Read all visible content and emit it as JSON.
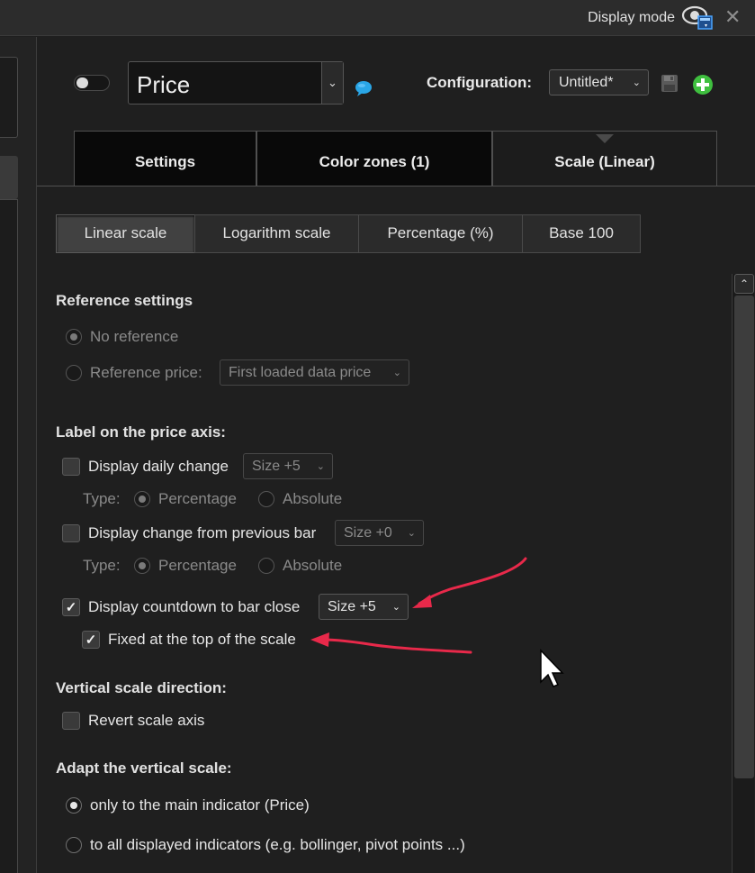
{
  "topbar": {
    "display_mode_label": "Display mode",
    "close_glyph": "✕"
  },
  "indicator": {
    "name": "Price",
    "chevron": "⌄"
  },
  "configuration": {
    "label": "Configuration:",
    "value": "Untitled*",
    "chevron": "⌄"
  },
  "tabs": [
    {
      "label": "Settings"
    },
    {
      "label": "Color zones (1)"
    },
    {
      "label": "Scale (Linear)"
    }
  ],
  "scale_types": [
    {
      "label": "Linear scale"
    },
    {
      "label": "Logarithm scale"
    },
    {
      "label": "Percentage (%)"
    },
    {
      "label": "Base 100"
    }
  ],
  "reference": {
    "heading": "Reference settings",
    "no_reference": "No reference",
    "reference_price": "Reference price:",
    "reference_select": "First loaded data price",
    "chevron": "⌄"
  },
  "label_axis": {
    "heading": "Label on the price axis:",
    "daily_change": "Display daily change",
    "daily_change_size": "Size +5",
    "type_label": "Type:",
    "percentage": "Percentage",
    "absolute": "Absolute",
    "change_prev_bar": "Display change from previous bar",
    "change_prev_size": "Size +0",
    "countdown": "Display countdown to bar close",
    "countdown_size": "Size +5",
    "fixed_top": "Fixed at the top of the scale",
    "check_glyph": "✓",
    "chevron": "⌄"
  },
  "vertical_direction": {
    "heading": "Vertical scale direction:",
    "revert": "Revert scale axis"
  },
  "adapt": {
    "heading": "Adapt the vertical scale:",
    "main_only": "only to the main indicator (Price)",
    "all_indicators": "to all displayed indicators (e.g. bollinger, pivot points ...)"
  },
  "scrollbar": {
    "up_glyph": "⌃"
  },
  "colors": {
    "annotation_arrow": "#e8294a",
    "add_button": "#3fbf3f",
    "bubble": "#2aa6e6"
  },
  "icons": [
    "eye-monitor-icon",
    "close-icon",
    "chat-bubble-icon",
    "save-icon",
    "add-icon",
    "chevron-down-icon",
    "chevron-up-icon",
    "check-icon",
    "mouse-cursor-icon",
    "annotation-arrow-icon"
  ]
}
